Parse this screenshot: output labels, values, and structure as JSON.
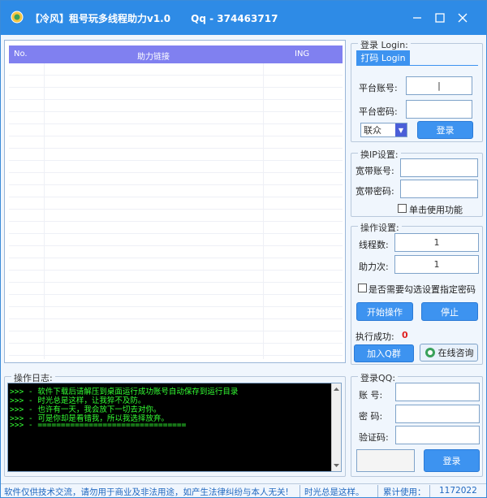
{
  "window": {
    "title": "【冷风】租号玩多线程助力v1.0      Qq - 374463717"
  },
  "list": {
    "columns": [
      "No.",
      "助力链接",
      "ING"
    ]
  },
  "login_group": {
    "title": "登录 Login:",
    "tab_label": "打码 Login",
    "account_label": "平台账号:",
    "password_label": "平台密码:",
    "account_value": "|",
    "provider_value": "联众",
    "login_button": "登录"
  },
  "ip_group": {
    "title": "换IP设置:",
    "account_label": "宽带账号:",
    "password_label": "宽带密码:",
    "single_label": "单击使用功能"
  },
  "ops_group": {
    "title": "操作设置:",
    "threads_label": "线程数:",
    "threads_value": "1",
    "assist_label": "助力次:",
    "assist_value": "1",
    "check_label": "是否需要勾选设置指定密码",
    "start_button": "开始操作",
    "stop_button": "停止",
    "success_label": "执行成功:",
    "success_value": "0",
    "join_button": "加入Q群",
    "consult_button": "在线咨询"
  },
  "log": {
    "title": "操作日志:",
    "lines": [
      ">>> - 软件下载后请解压到桌面运行成功账号自动保存到运行目录",
      ">>> - 时光总是这样，让我猝不及防。",
      ">>> - 也许有一天，我会放下一切去对你。",
      ">>> - 可是你却是看错我，所以我选择放弃。",
      ">>> - ================================"
    ]
  },
  "qq_group": {
    "title": "登录QQ:",
    "account_label": "账  号:",
    "password_label": "密  码:",
    "captcha_label": "验证码:",
    "login_button": "登录"
  },
  "status": {
    "disclaimer": "软件仅供技术交流，请勿用于商业及非法用途，如产生法律纠纷与本人无关!",
    "motto": "时光总是这样。",
    "usage_label": "累计使用：",
    "usage_value": "1172022"
  },
  "colors": {
    "titlebar": "#2e8be6",
    "button": "#3d93f0",
    "list_header": "#8080f0",
    "log_text": "#33ff33",
    "success_value": "#e02020"
  }
}
